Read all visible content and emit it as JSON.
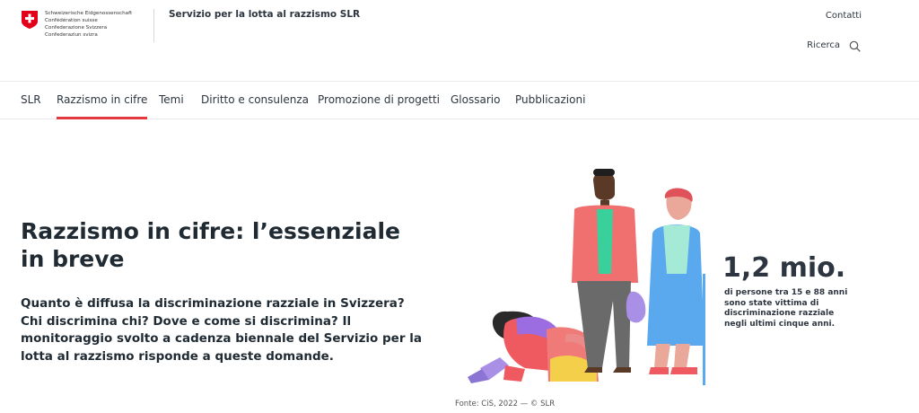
{
  "header": {
    "logo_lines": [
      "Schweizerische Eidgenossenschaft",
      "Confédération suisse",
      "Confederazione Svizzera",
      "Confederaziun svizra"
    ],
    "site_title": "Servizio per la lotta al razzismo SLR",
    "contact_link": "Contatti",
    "search_label": "Ricerca",
    "flag_color": "#e2001a"
  },
  "nav": {
    "items": [
      {
        "label": "SLR"
      },
      {
        "label": "Razzismo in cifre"
      },
      {
        "label": "Temi"
      },
      {
        "label": "Diritto e consulenza"
      },
      {
        "label": "Promozione di progetti"
      },
      {
        "label": "Glossario"
      },
      {
        "label": "Pubblicazioni"
      }
    ],
    "active_index": 1,
    "active_color": "#e53940"
  },
  "hero": {
    "title": "Razzismo in cifre: l’essenziale in breve",
    "lead": "Quanto è diffusa la discriminazione razziale in Svizzera? Chi discrimina chi? Dove e come si discrimina? Il monitoraggio svolto a cadenza biennale del Servizio per la lotta al razzismo risponde a queste domande.",
    "stat_value": "1,2 mio.",
    "stat_description": "di persone tra 15 e 88 anni sono state vittima di discriminazione razziale negli ultimi cinque anni.",
    "source": "Fonte: CiS, 2022 — © SLR"
  }
}
